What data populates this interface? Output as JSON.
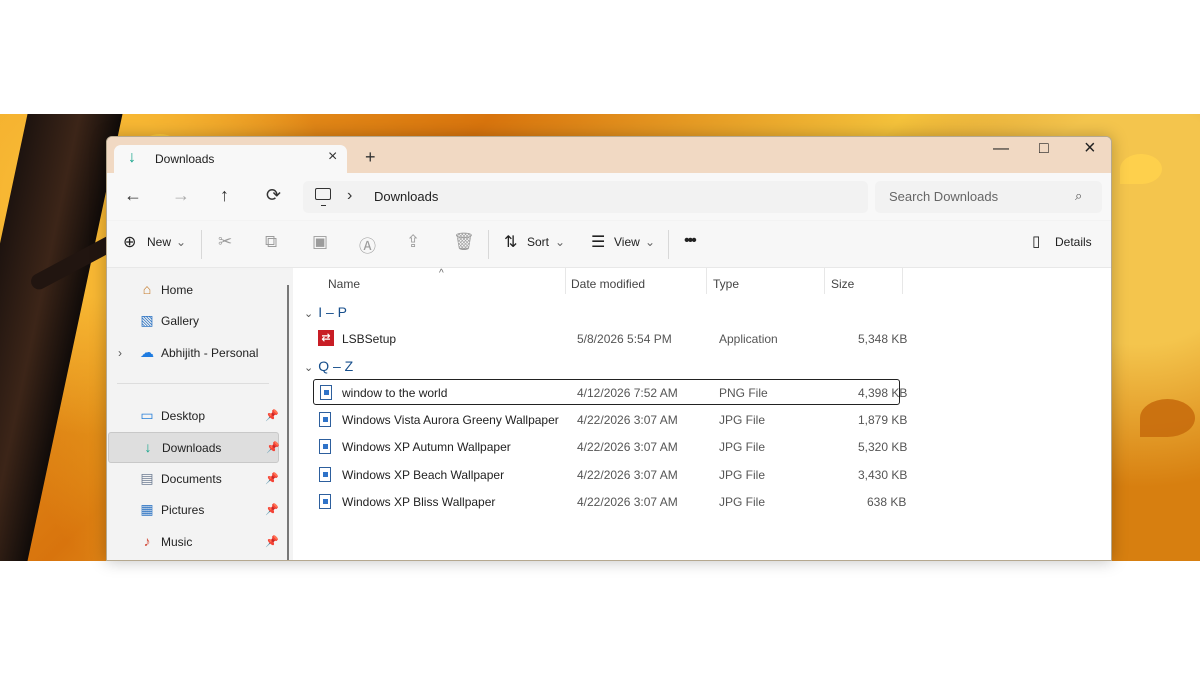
{
  "window": {
    "tab_title": "Downloads",
    "new_tab": "+",
    "tab_close": "×",
    "minimize": "—",
    "maximize": "□",
    "close": "×"
  },
  "navigation": {
    "back": "←",
    "forward": "→",
    "up": "↑",
    "refresh": "⟳",
    "breadcrumb_separator": "›",
    "location": "Downloads",
    "search_placeholder": "Search Downloads",
    "search_icon": "⌕"
  },
  "toolbar": {
    "new": "New",
    "new_icon": "⊕",
    "new_chevron": "⌄",
    "cut_icon": "✂",
    "copy_icon": "⧉",
    "paste_icon": "▣",
    "rename_icon": "Ⓐ",
    "share_icon": "⇪",
    "delete_icon": "🗑",
    "sort": "Sort",
    "sort_icon": "⇅",
    "sort_chevron": "⌄",
    "view": "View",
    "view_icon": "☰",
    "view_chevron": "⌄",
    "more": "•••",
    "details": "Details",
    "details_icon": "▯"
  },
  "sidebar": {
    "items": [
      {
        "label": "Home",
        "icon": "⌂"
      },
      {
        "label": "Gallery",
        "icon": "▧"
      },
      {
        "label": "Abhijith - Personal",
        "icon": "☁",
        "expander": "›"
      },
      {
        "label": "Desktop",
        "icon": "▭",
        "pin": "📌"
      },
      {
        "label": "Downloads",
        "icon": "↓",
        "pin": "📌"
      },
      {
        "label": "Documents",
        "icon": "▤",
        "pin": "📌"
      },
      {
        "label": "Pictures",
        "icon": "▦",
        "pin": "📌"
      },
      {
        "label": "Music",
        "icon": "♪",
        "pin": "📌"
      }
    ]
  },
  "file_list": {
    "columns": [
      "Name",
      "Date modified",
      "Type",
      "Size"
    ],
    "sort_indicator": "^",
    "groups": [
      {
        "label": "I – P",
        "chevron": "⌄",
        "files": [
          {
            "name": "LSBSetup",
            "date": "5/8/2026 5:54 PM",
            "type": "Application",
            "size": "5,348 KB",
            "icon": "⇄"
          }
        ]
      },
      {
        "label": "Q – Z",
        "chevron": "⌄",
        "files": [
          {
            "name": "window to the world",
            "date": "4/12/2026 7:52 AM",
            "type": "PNG File",
            "size": "4,398 KB"
          },
          {
            "name": "Windows Vista Aurora Greeny Wallpaper",
            "date": "4/22/2026 3:07 AM",
            "type": "JPG File",
            "size": "1,879 KB"
          },
          {
            "name": "Windows XP Autumn Wallpaper",
            "date": "4/22/2026 3:07 AM",
            "type": "JPG File",
            "size": "5,320 KB"
          },
          {
            "name": "Windows XP Beach Wallpaper",
            "date": "4/22/2026 3:07 AM",
            "type": "JPG File",
            "size": "3,430 KB"
          },
          {
            "name": "Windows XP Bliss Wallpaper",
            "date": "4/22/2026 3:07 AM",
            "type": "JPG File",
            "size": "638 KB"
          }
        ]
      }
    ]
  },
  "colors": {
    "group_heading": "#174f8c",
    "download_accent": "#13a38a",
    "application_icon": "#c81d25"
  }
}
